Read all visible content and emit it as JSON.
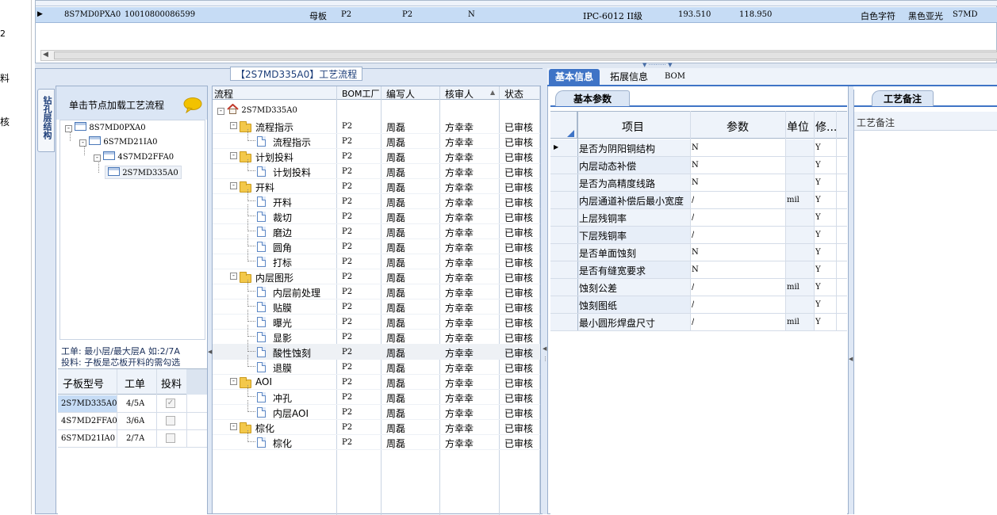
{
  "left_edge": {
    "chars": [
      "2",
      "料",
      "核"
    ]
  },
  "top_grid": {
    "row": {
      "c1": "8S7MD0PXA0",
      "c2": "10010800086599",
      "c3": "母板",
      "c4": "P2",
      "c5": "P2",
      "c6": "N",
      "c7": "IPC-6012 II级",
      "c8": "193.510",
      "c9": "118.950",
      "c10": "白色字符",
      "c11": "黑色亚光",
      "c12": "S7MD"
    }
  },
  "flow_panel": {
    "title": "【2S7MD335A0】工艺流程",
    "side_tab": "钻孔层结构",
    "hint": "单击节点加载工艺流程",
    "tree": [
      {
        "label": "8S7MD0PXA0",
        "level": 0
      },
      {
        "label": "6S7MD21IA0",
        "level": 1
      },
      {
        "label": "4S7MD2FFA0",
        "level": 2
      },
      {
        "label": "2S7MD335A0",
        "level": 3
      }
    ],
    "note1": "工单: 最小层/最大层A 如:2/7A",
    "note2": "投料: 子板是芯板开料的需勾选",
    "sub_headers": [
      "子板型号",
      "工单",
      "投料"
    ],
    "sub_rows": [
      {
        "model": "2S7MD335A0",
        "order": "4/5A",
        "checked": "✓"
      },
      {
        "model": "4S7MD2FFA0",
        "order": "3/6A",
        "checked": ""
      },
      {
        "model": "6S7MD21IA0",
        "order": "2/7A",
        "checked": ""
      }
    ]
  },
  "process_grid": {
    "headers": [
      "流程",
      "BOM工厂",
      "编写人",
      "核审人",
      "状态"
    ],
    "root": "2S7MD335A0",
    "rows": [
      {
        "name": "流程指示",
        "folder": true,
        "f": "P2",
        "w": "周磊",
        "r": "方幸幸",
        "s": "已审核"
      },
      {
        "name": "流程指示",
        "folder": false,
        "f": "P2",
        "w": "周磊",
        "r": "方幸幸",
        "s": "已审核"
      },
      {
        "name": "计划投料",
        "folder": true,
        "f": "P2",
        "w": "周磊",
        "r": "方幸幸",
        "s": "已审核"
      },
      {
        "name": "计划投料",
        "folder": false,
        "f": "P2",
        "w": "周磊",
        "r": "方幸幸",
        "s": "已审核"
      },
      {
        "name": "开料",
        "folder": true,
        "f": "P2",
        "w": "周磊",
        "r": "方幸幸",
        "s": "已审核"
      },
      {
        "name": "开料",
        "folder": false,
        "f": "P2",
        "w": "周磊",
        "r": "方幸幸",
        "s": "已审核"
      },
      {
        "name": "裁切",
        "folder": false,
        "f": "P2",
        "w": "周磊",
        "r": "方幸幸",
        "s": "已审核"
      },
      {
        "name": "磨边",
        "folder": false,
        "f": "P2",
        "w": "周磊",
        "r": "方幸幸",
        "s": "已审核"
      },
      {
        "name": "圆角",
        "folder": false,
        "f": "P2",
        "w": "周磊",
        "r": "方幸幸",
        "s": "已审核"
      },
      {
        "name": "打标",
        "folder": false,
        "f": "P2",
        "w": "周磊",
        "r": "方幸幸",
        "s": "已审核"
      },
      {
        "name": "内层图形",
        "folder": true,
        "f": "P2",
        "w": "周磊",
        "r": "方幸幸",
        "s": "已审核"
      },
      {
        "name": "内层前处理",
        "folder": false,
        "f": "P2",
        "w": "周磊",
        "r": "方幸幸",
        "s": "已审核"
      },
      {
        "name": "贴膜",
        "folder": false,
        "f": "P2",
        "w": "周磊",
        "r": "方幸幸",
        "s": "已审核"
      },
      {
        "name": "曝光",
        "folder": false,
        "f": "P2",
        "w": "周磊",
        "r": "方幸幸",
        "s": "已审核"
      },
      {
        "name": "显影",
        "folder": false,
        "f": "P2",
        "w": "周磊",
        "r": "方幸幸",
        "s": "已审核"
      },
      {
        "name": "酸性蚀刻",
        "folder": false,
        "f": "P2",
        "w": "周磊",
        "r": "方幸幸",
        "s": "已审核"
      },
      {
        "name": "退膜",
        "folder": false,
        "f": "P2",
        "w": "周磊",
        "r": "方幸幸",
        "s": "已审核"
      },
      {
        "name": "AOI",
        "folder": true,
        "f": "P2",
        "w": "周磊",
        "r": "方幸幸",
        "s": "已审核"
      },
      {
        "name": "冲孔",
        "folder": false,
        "f": "P2",
        "w": "周磊",
        "r": "方幸幸",
        "s": "已审核"
      },
      {
        "name": "内层AOI",
        "folder": false,
        "f": "P2",
        "w": "周磊",
        "r": "方幸幸",
        "s": "已审核"
      },
      {
        "name": "棕化",
        "folder": true,
        "f": "P2",
        "w": "周磊",
        "r": "方幸幸",
        "s": "已审核"
      },
      {
        "name": "棕化",
        "folder": false,
        "f": "P2",
        "w": "周磊",
        "r": "方幸幸",
        "s": "已审核"
      }
    ]
  },
  "info_panel": {
    "tabs": [
      "基本信息",
      "拓展信息",
      "BOM"
    ],
    "sub_tab": "基本参数",
    "headers": [
      "项目",
      "参数",
      "单位",
      "修..."
    ],
    "rows": [
      {
        "item": "是否为阴阳铜结构",
        "param": "N",
        "unit": "",
        "mod": "Y"
      },
      {
        "item": "内层动态补偿",
        "param": "N",
        "unit": "",
        "mod": "Y"
      },
      {
        "item": "是否为高精度线路",
        "param": "N",
        "unit": "",
        "mod": "Y"
      },
      {
        "item": "内层通道补偿后最小宽度",
        "param": "/",
        "unit": "mil",
        "mod": "Y"
      },
      {
        "item": "上层残铜率",
        "param": "/",
        "unit": "",
        "mod": "Y"
      },
      {
        "item": "下层残铜率",
        "param": "/",
        "unit": "",
        "mod": "Y"
      },
      {
        "item": "是否单面蚀刻",
        "param": "N",
        "unit": "",
        "mod": "Y"
      },
      {
        "item": "是否有缝宽要求",
        "param": "N",
        "unit": "",
        "mod": "Y"
      },
      {
        "item": "蚀刻公差",
        "param": "/",
        "unit": "mil",
        "mod": "Y"
      },
      {
        "item": "蚀刻图纸",
        "param": "/",
        "unit": "",
        "mod": "Y"
      },
      {
        "item": "最小圆形焊盘尺寸",
        "param": "/",
        "unit": "mil",
        "mod": "Y"
      }
    ]
  },
  "remark_panel": {
    "tab": "工艺备注",
    "label": "工艺备注"
  },
  "colors": {
    "selected_row": "#c6dcf5",
    "tab_active": "#3f74c6",
    "header_bg": "#eef3fa"
  }
}
